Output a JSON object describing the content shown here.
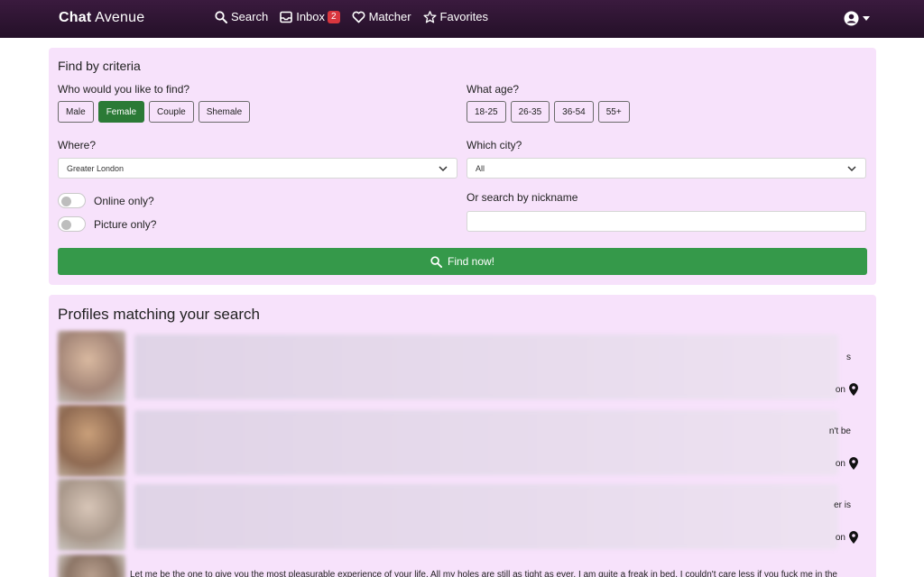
{
  "navbar": {
    "brand_bold": "Chat",
    "brand_rest": " Avenue",
    "search_label": "Search",
    "inbox_label": "Inbox",
    "inbox_count": "2",
    "matcher_label": "Matcher",
    "favorites_label": "Favorites"
  },
  "search": {
    "title": "Find by criteria",
    "who_label": "Who would you like to find?",
    "genders": [
      "Male",
      "Female",
      "Couple",
      "Shemale"
    ],
    "selected_gender": "Female",
    "age_label": "What age?",
    "ages": [
      "18-25",
      "26-35",
      "36-54",
      "55+"
    ],
    "where_label": "Where?",
    "where_value": "Greater London",
    "city_label": "Which city?",
    "city_value": "All",
    "online_label": "Online only?",
    "picture_label": "Picture only?",
    "nickname_label": "Or search by nickname",
    "nickname_value": "",
    "find_button": "Find now!"
  },
  "results": {
    "title": "Profiles matching your search",
    "profiles": [
      {
        "snippet_end": "s",
        "location_tail": "on"
      },
      {
        "snippet_end": "n't be",
        "location_tail": "on"
      },
      {
        "snippet_end": "er is",
        "location_tail": "on"
      }
    ],
    "last_snippet": "Let me be the one to give you the most pleasurable experience of your life. All my holes are still as tight as ever. I am quite a freak in bed. I couldn't care less if you fuck me in the"
  },
  "colors": {
    "navbar": "#2e1533",
    "panel": "#f7e2fb",
    "active_button": "#2b7a36",
    "find_button": "#35994a",
    "badge": "#d9363e"
  }
}
